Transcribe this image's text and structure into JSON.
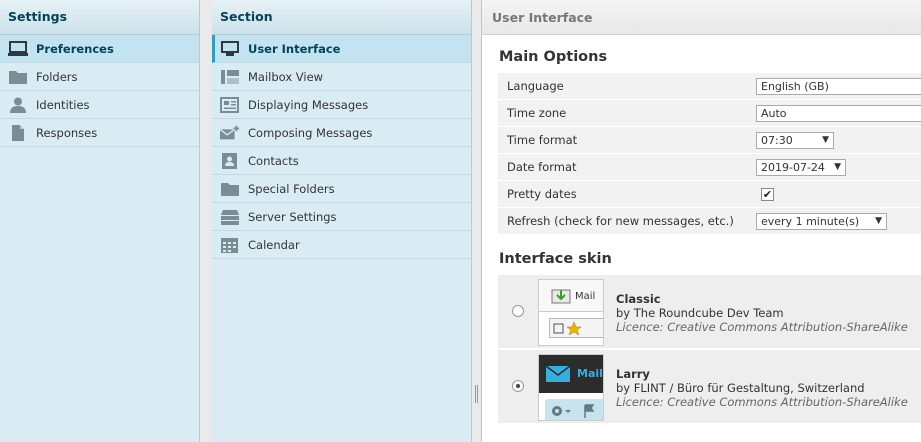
{
  "settings": {
    "title": "Settings",
    "items": [
      {
        "label": "Preferences",
        "icon": "monitor-icon",
        "selected": true
      },
      {
        "label": "Folders",
        "icon": "folder-icon"
      },
      {
        "label": "Identities",
        "icon": "person-icon"
      },
      {
        "label": "Responses",
        "icon": "document-icon"
      }
    ]
  },
  "section": {
    "title": "Section",
    "items": [
      {
        "label": "User Interface",
        "icon": "monitor-icon",
        "selected": true
      },
      {
        "label": "Mailbox View",
        "icon": "layout-icon"
      },
      {
        "label": "Displaying Messages",
        "icon": "newspaper-icon"
      },
      {
        "label": "Composing Messages",
        "icon": "envelope-plus-icon"
      },
      {
        "label": "Contacts",
        "icon": "contact-card-icon"
      },
      {
        "label": "Special Folders",
        "icon": "folder-icon"
      },
      {
        "label": "Server Settings",
        "icon": "server-icon"
      },
      {
        "label": "Calendar",
        "icon": "calendar-icon"
      }
    ]
  },
  "main": {
    "title": "User Interface",
    "main_options_title": "Main Options",
    "options": {
      "language": {
        "label": "Language",
        "value": "English (GB)"
      },
      "timezone": {
        "label": "Time zone",
        "value": "Auto"
      },
      "time_format": {
        "label": "Time format",
        "value": "07:30"
      },
      "date_format": {
        "label": "Date format",
        "value": "2019-07-24"
      },
      "pretty_dates": {
        "label": "Pretty dates",
        "checked": true,
        "check_mark": "✔"
      },
      "refresh": {
        "label": "Refresh (check for new messages, etc.)",
        "value": "every 1 minute(s)"
      }
    },
    "dropdown_arrow": "▼",
    "skin_title": "Interface skin",
    "skins": [
      {
        "name": "Classic",
        "author": "by The Roundcube Dev Team",
        "license": "Licence: Creative Commons Attribution-ShareAlike",
        "thumb_label": "Mail",
        "selected": false
      },
      {
        "name": "Larry",
        "author": "by FLINT / Büro für Gestaltung, Switzerland",
        "license": "Licence: Creative Commons Attribution-ShareAlike",
        "thumb_label": "Mail",
        "selected": true
      }
    ]
  },
  "colors": {
    "panel_bg": "#d9ecf4",
    "header_text": "#004458",
    "selected_bg": "#c4e3f0",
    "icon": "#7b8c94"
  }
}
